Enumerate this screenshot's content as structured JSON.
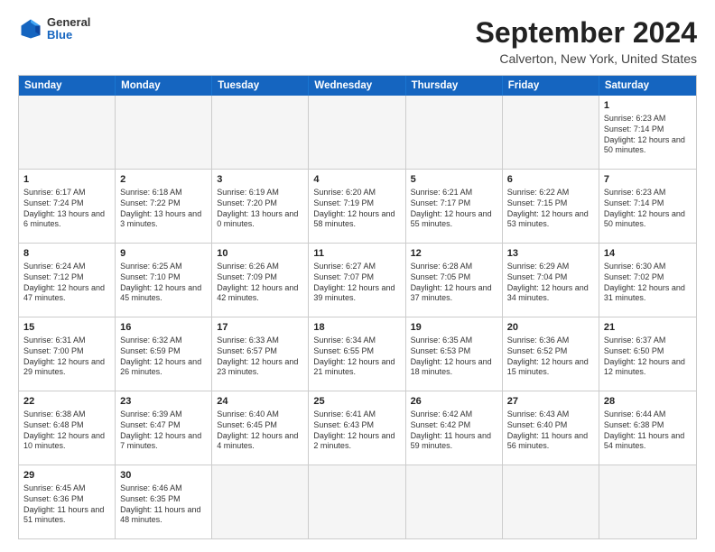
{
  "header": {
    "logo": {
      "general": "General",
      "blue": "Blue"
    },
    "title": "September 2024",
    "subtitle": "Calverton, New York, United States"
  },
  "calendar": {
    "days_of_week": [
      "Sunday",
      "Monday",
      "Tuesday",
      "Wednesday",
      "Thursday",
      "Friday",
      "Saturday"
    ],
    "weeks": [
      [
        {
          "day": "",
          "empty": true
        },
        {
          "day": "",
          "empty": true
        },
        {
          "day": "",
          "empty": true
        },
        {
          "day": "",
          "empty": true
        },
        {
          "day": "",
          "empty": true
        },
        {
          "day": "",
          "empty": true
        },
        {
          "day": "1",
          "sunrise": "Sunrise: 6:23 AM",
          "sunset": "Sunset: 7:14 PM",
          "daylight": "Daylight: 12 hours and 50 minutes."
        }
      ],
      [
        {
          "day": "1",
          "sunrise": "Sunrise: 6:17 AM",
          "sunset": "Sunset: 7:24 PM",
          "daylight": "Daylight: 13 hours and 6 minutes."
        },
        {
          "day": "2",
          "sunrise": "Sunrise: 6:18 AM",
          "sunset": "Sunset: 7:22 PM",
          "daylight": "Daylight: 13 hours and 3 minutes."
        },
        {
          "day": "3",
          "sunrise": "Sunrise: 6:19 AM",
          "sunset": "Sunset: 7:20 PM",
          "daylight": "Daylight: 13 hours and 0 minutes."
        },
        {
          "day": "4",
          "sunrise": "Sunrise: 6:20 AM",
          "sunset": "Sunset: 7:19 PM",
          "daylight": "Daylight: 12 hours and 58 minutes."
        },
        {
          "day": "5",
          "sunrise": "Sunrise: 6:21 AM",
          "sunset": "Sunset: 7:17 PM",
          "daylight": "Daylight: 12 hours and 55 minutes."
        },
        {
          "day": "6",
          "sunrise": "Sunrise: 6:22 AM",
          "sunset": "Sunset: 7:15 PM",
          "daylight": "Daylight: 12 hours and 53 minutes."
        },
        {
          "day": "7",
          "sunrise": "Sunrise: 6:23 AM",
          "sunset": "Sunset: 7:14 PM",
          "daylight": "Daylight: 12 hours and 50 minutes."
        }
      ],
      [
        {
          "day": "8",
          "sunrise": "Sunrise: 6:24 AM",
          "sunset": "Sunset: 7:12 PM",
          "daylight": "Daylight: 12 hours and 47 minutes."
        },
        {
          "day": "9",
          "sunrise": "Sunrise: 6:25 AM",
          "sunset": "Sunset: 7:10 PM",
          "daylight": "Daylight: 12 hours and 45 minutes."
        },
        {
          "day": "10",
          "sunrise": "Sunrise: 6:26 AM",
          "sunset": "Sunset: 7:09 PM",
          "daylight": "Daylight: 12 hours and 42 minutes."
        },
        {
          "day": "11",
          "sunrise": "Sunrise: 6:27 AM",
          "sunset": "Sunset: 7:07 PM",
          "daylight": "Daylight: 12 hours and 39 minutes."
        },
        {
          "day": "12",
          "sunrise": "Sunrise: 6:28 AM",
          "sunset": "Sunset: 7:05 PM",
          "daylight": "Daylight: 12 hours and 37 minutes."
        },
        {
          "day": "13",
          "sunrise": "Sunrise: 6:29 AM",
          "sunset": "Sunset: 7:04 PM",
          "daylight": "Daylight: 12 hours and 34 minutes."
        },
        {
          "day": "14",
          "sunrise": "Sunrise: 6:30 AM",
          "sunset": "Sunset: 7:02 PM",
          "daylight": "Daylight: 12 hours and 31 minutes."
        }
      ],
      [
        {
          "day": "15",
          "sunrise": "Sunrise: 6:31 AM",
          "sunset": "Sunset: 7:00 PM",
          "daylight": "Daylight: 12 hours and 29 minutes."
        },
        {
          "day": "16",
          "sunrise": "Sunrise: 6:32 AM",
          "sunset": "Sunset: 6:59 PM",
          "daylight": "Daylight: 12 hours and 26 minutes."
        },
        {
          "day": "17",
          "sunrise": "Sunrise: 6:33 AM",
          "sunset": "Sunset: 6:57 PM",
          "daylight": "Daylight: 12 hours and 23 minutes."
        },
        {
          "day": "18",
          "sunrise": "Sunrise: 6:34 AM",
          "sunset": "Sunset: 6:55 PM",
          "daylight": "Daylight: 12 hours and 21 minutes."
        },
        {
          "day": "19",
          "sunrise": "Sunrise: 6:35 AM",
          "sunset": "Sunset: 6:53 PM",
          "daylight": "Daylight: 12 hours and 18 minutes."
        },
        {
          "day": "20",
          "sunrise": "Sunrise: 6:36 AM",
          "sunset": "Sunset: 6:52 PM",
          "daylight": "Daylight: 12 hours and 15 minutes."
        },
        {
          "day": "21",
          "sunrise": "Sunrise: 6:37 AM",
          "sunset": "Sunset: 6:50 PM",
          "daylight": "Daylight: 12 hours and 12 minutes."
        }
      ],
      [
        {
          "day": "22",
          "sunrise": "Sunrise: 6:38 AM",
          "sunset": "Sunset: 6:48 PM",
          "daylight": "Daylight: 12 hours and 10 minutes."
        },
        {
          "day": "23",
          "sunrise": "Sunrise: 6:39 AM",
          "sunset": "Sunset: 6:47 PM",
          "daylight": "Daylight: 12 hours and 7 minutes."
        },
        {
          "day": "24",
          "sunrise": "Sunrise: 6:40 AM",
          "sunset": "Sunset: 6:45 PM",
          "daylight": "Daylight: 12 hours and 4 minutes."
        },
        {
          "day": "25",
          "sunrise": "Sunrise: 6:41 AM",
          "sunset": "Sunset: 6:43 PM",
          "daylight": "Daylight: 12 hours and 2 minutes."
        },
        {
          "day": "26",
          "sunrise": "Sunrise: 6:42 AM",
          "sunset": "Sunset: 6:42 PM",
          "daylight": "Daylight: 11 hours and 59 minutes."
        },
        {
          "day": "27",
          "sunrise": "Sunrise: 6:43 AM",
          "sunset": "Sunset: 6:40 PM",
          "daylight": "Daylight: 11 hours and 56 minutes."
        },
        {
          "day": "28",
          "sunrise": "Sunrise: 6:44 AM",
          "sunset": "Sunset: 6:38 PM",
          "daylight": "Daylight: 11 hours and 54 minutes."
        }
      ],
      [
        {
          "day": "29",
          "sunrise": "Sunrise: 6:45 AM",
          "sunset": "Sunset: 6:36 PM",
          "daylight": "Daylight: 11 hours and 51 minutes."
        },
        {
          "day": "30",
          "sunrise": "Sunrise: 6:46 AM",
          "sunset": "Sunset: 6:35 PM",
          "daylight": "Daylight: 11 hours and 48 minutes."
        },
        {
          "day": "",
          "empty": true
        },
        {
          "day": "",
          "empty": true
        },
        {
          "day": "",
          "empty": true
        },
        {
          "day": "",
          "empty": true
        },
        {
          "day": "",
          "empty": true
        }
      ]
    ]
  }
}
